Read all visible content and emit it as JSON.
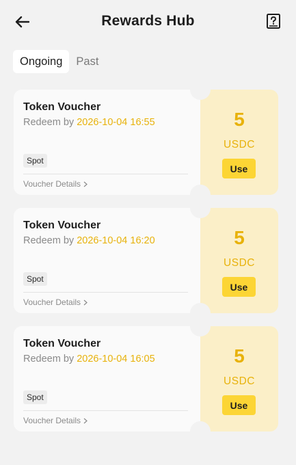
{
  "header": {
    "title": "Rewards Hub",
    "back_icon": "arrow-left-icon",
    "help_icon": "question-book-icon"
  },
  "tabs": [
    {
      "label": "Ongoing",
      "active": true
    },
    {
      "label": "Past",
      "active": false
    }
  ],
  "vouchers": [
    {
      "title": "Token Voucher",
      "redeem_prefix": "Redeem by",
      "redeem_date": "2026-10-04 16:55",
      "tag": "Spot",
      "details_label": "Voucher Details",
      "amount": "5",
      "unit": "USDC",
      "use_label": "Use"
    },
    {
      "title": "Token Voucher",
      "redeem_prefix": "Redeem by",
      "redeem_date": "2026-10-04 16:20",
      "tag": "Spot",
      "details_label": "Voucher Details",
      "amount": "5",
      "unit": "USDC",
      "use_label": "Use"
    },
    {
      "title": "Token Voucher",
      "redeem_prefix": "Redeem by",
      "redeem_date": "2026-10-04 16:05",
      "tag": "Spot",
      "details_label": "Voucher Details",
      "amount": "5",
      "unit": "USDC",
      "use_label": "Use"
    }
  ],
  "colors": {
    "accent": "#e8b20b",
    "button": "#fcd535",
    "voucher_right_bg": "#fbefc8",
    "page_bg": "#f2f2f2"
  }
}
